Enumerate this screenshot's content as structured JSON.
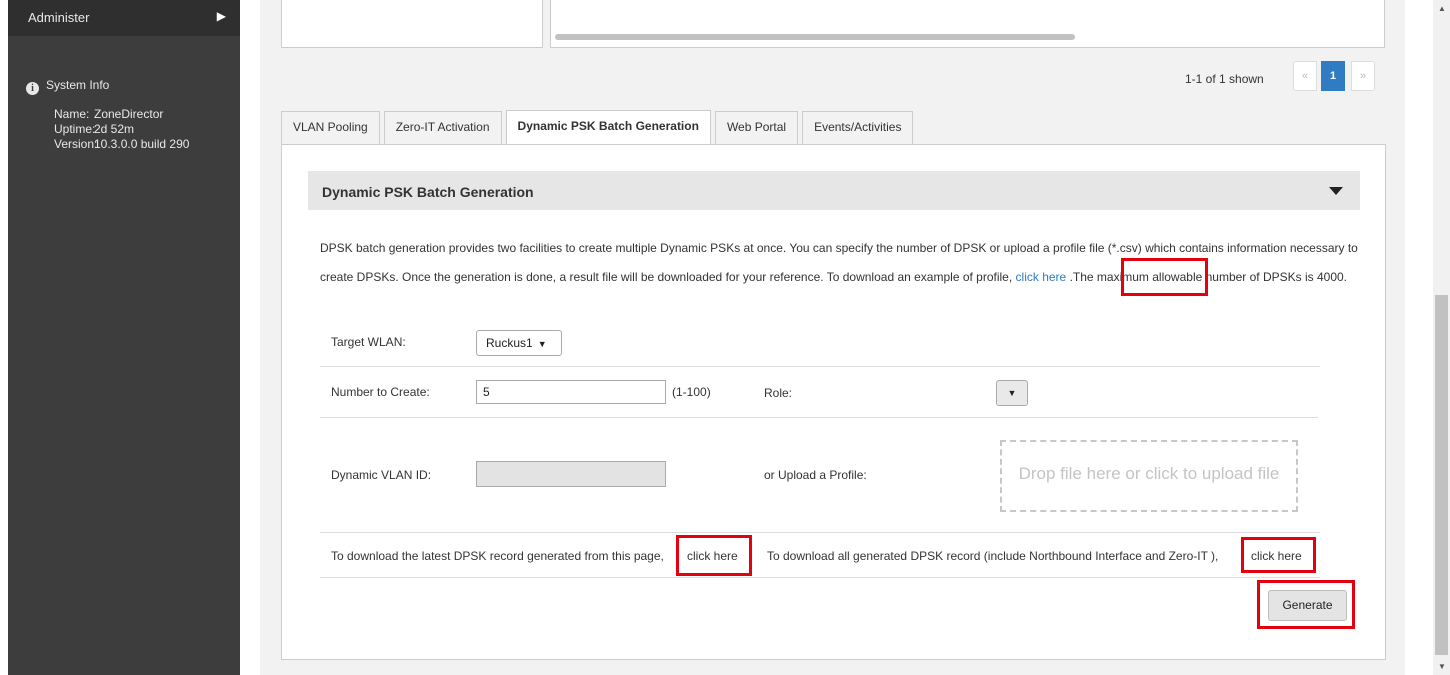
{
  "sidebar": {
    "administer": "Administer",
    "system_info_title": "System Info",
    "info": [
      {
        "key": "Name:",
        "value": "ZoneDirector"
      },
      {
        "key": "Uptime:",
        "value": "2d 52m"
      },
      {
        "key": "Version:",
        "value": "10.3.0.0 build 290"
      }
    ]
  },
  "pager": {
    "summary": "1-1 of 1 shown",
    "prev": "«",
    "current": "1",
    "next": "»"
  },
  "tabs": [
    "VLAN Pooling",
    "Zero-IT Activation",
    "Dynamic PSK Batch Generation",
    "Web Portal",
    "Events/Activities"
  ],
  "section": {
    "title": "Dynamic PSK Batch Generation",
    "desc_part1": "DPSK batch generation provides two facilities to create multiple Dynamic PSKs at once. You can specify the number of DPSK or upload a profile file (*.csv) which contains information necessary to create DPSKs. Once the generation is done, a result file will be downloaded for your reference. To download an example of profile,",
    "desc_link": "click here",
    "desc_part2": ".The maximum allowable number of DPSKs is 4000."
  },
  "form": {
    "target_wlan_label": "Target WLAN:",
    "target_wlan_value": "Ruckus1",
    "number_label": "Number to Create:",
    "number_value": "5",
    "number_range": "(1-100)",
    "role_label": "Role:",
    "vlan_label": "Dynamic VLAN ID:",
    "upload_label": "or Upload a Profile:",
    "dropzone_text": "Drop file here or click to upload file",
    "download_latest_text": "To download the latest DPSK record generated from this page,",
    "download_latest_link": "click here",
    "download_all_text": "To download all generated DPSK record (include Northbound Interface and Zero-IT ),",
    "download_all_link": "click here",
    "generate_label": "Generate"
  },
  "colors": {
    "sidebar": "#3d3d3d",
    "link": "#2f7cc2",
    "highlight": "#e3000f",
    "pager_active": "#2f7cc2"
  }
}
